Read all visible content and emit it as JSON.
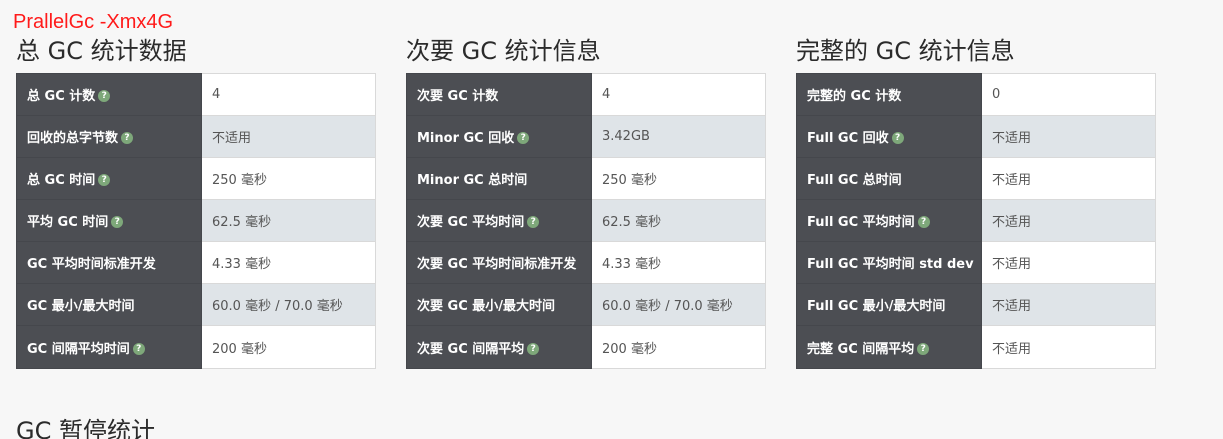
{
  "annotation": "PrallelGc -Xmx4G",
  "sections": [
    {
      "title": "总 GC 统计数据",
      "rows": [
        {
          "label": "总 GC 计数",
          "value": "4",
          "help": true
        },
        {
          "label": "回收的总字节数",
          "value": "不适用",
          "help": true
        },
        {
          "label": "总 GC 时间",
          "value": "250 毫秒",
          "help": true
        },
        {
          "label": "平均 GC 时间",
          "value": "62.5 毫秒",
          "help": true
        },
        {
          "label": "GC 平均时间标准开发",
          "value": "4.33 毫秒",
          "help": false
        },
        {
          "label": "GC 最小/最大时间",
          "value": "60.0 毫秒 / 70.0 毫秒",
          "help": false
        },
        {
          "label": "GC 间隔平均时间",
          "value": "200 毫秒",
          "help": true
        }
      ]
    },
    {
      "title": "次要 GC 统计信息",
      "rows": [
        {
          "label": "次要 GC 计数",
          "value": "4",
          "help": false
        },
        {
          "label": "Minor GC 回收",
          "value": "3.42GB",
          "help": true
        },
        {
          "label": "Minor GC 总时间",
          "value": "250 毫秒",
          "help": false
        },
        {
          "label": "次要 GC 平均时间",
          "value": "62.5 毫秒",
          "help": true
        },
        {
          "label": "次要 GC 平均时间标准开发",
          "value": "4.33 毫秒",
          "help": false
        },
        {
          "label": "次要 GC 最小/最大时间",
          "value": "60.0 毫秒 / 70.0 毫秒",
          "help": false
        },
        {
          "label": "次要 GC 间隔平均",
          "value": "200 毫秒",
          "help": true
        }
      ]
    },
    {
      "title": "完整的 GC 统计信息",
      "rows": [
        {
          "label": "完整的 GC 计数",
          "value": "0",
          "help": false
        },
        {
          "label": "Full GC 回收",
          "value": "不适用",
          "help": true
        },
        {
          "label": "Full GC 总时间",
          "value": "不适用",
          "help": false
        },
        {
          "label": "Full GC 平均时间",
          "value": "不适用",
          "help": true
        },
        {
          "label": "Full GC 平均时间 std dev",
          "value": "不适用",
          "help": false
        },
        {
          "label": "Full GC 最小/最大时间",
          "value": "不适用",
          "help": false
        },
        {
          "label": "完整 GC 间隔平均",
          "value": "不适用",
          "help": true
        }
      ]
    }
  ],
  "pause_title": "GC 暂停统计",
  "colors": {
    "annotation": "#ff1a1a",
    "label_bg": "#4c4e53",
    "alt_row_bg": "#dfe4e8",
    "help_icon": "#7ea87a"
  }
}
